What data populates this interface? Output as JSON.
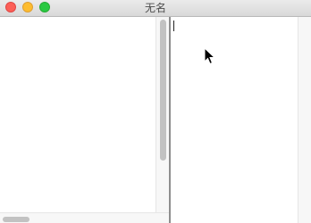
{
  "window": {
    "title": "无名",
    "controls": {
      "close": {
        "color": "#fc5f57",
        "icon": "close-icon"
      },
      "minimize": {
        "color": "#fdbc2e",
        "icon": "minimize-icon"
      },
      "zoom": {
        "color": "#29c941",
        "icon": "zoom-icon"
      }
    }
  },
  "left_pane": {
    "content": ""
  },
  "right_pane": {
    "text": ""
  },
  "cursor": {
    "icon": "arrow-pointer-icon"
  }
}
